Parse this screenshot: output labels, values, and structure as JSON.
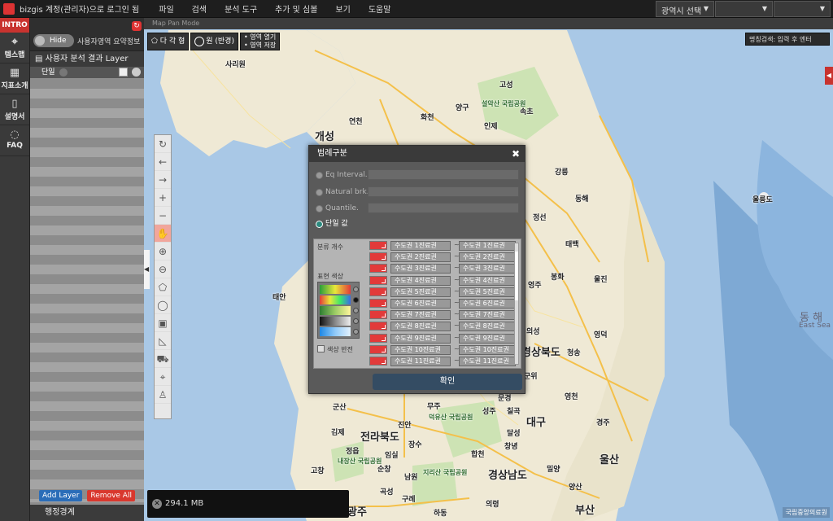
{
  "topbar": {
    "login_text": "bizgis 계정(관리자)으로 로그인 됨",
    "menus": [
      "파일",
      "검색",
      "분석 도구",
      "추가 및 심볼",
      "보기",
      "도움말"
    ],
    "region_select": "광역시 선택",
    "select2": "",
    "select3": ""
  },
  "leftnav": {
    "intro": "INTRO",
    "items": [
      {
        "label": "템스맵",
        "icon": "map-pin-icon"
      },
      {
        "label": "지표소개",
        "icon": "grid-icon"
      },
      {
        "label": "설명서",
        "icon": "book-icon"
      },
      {
        "label": "FAQ",
        "icon": "chat-icon"
      }
    ]
  },
  "panel": {
    "hide_label": "Hide",
    "summary_label": "사용자영역 요약정보",
    "layer_title": "사용자 분석 결과 Layer",
    "layer_item": "단일",
    "add_layer": "Add Layer",
    "remove_all": "Remove All",
    "boundary": "행정경계"
  },
  "map": {
    "mode_label": "Map Pan Mode",
    "tools": {
      "polygon": "다 각 형",
      "circle": "원 (반경)",
      "open_area": "• 영역 열기",
      "save_area": "• 영역 저장"
    },
    "place_search": "명칭검색: 입력 후 엔터",
    "memory": "294.1 MB",
    "copyright": "국립중앙의료원",
    "labels": [
      {
        "text": "개성",
        "cls": "big"
      },
      {
        "text": "사리원",
        "cls": ""
      },
      {
        "text": "양구",
        "cls": ""
      },
      {
        "text": "고성",
        "cls": ""
      },
      {
        "text": "속초",
        "cls": ""
      },
      {
        "text": "설악산 국립공원",
        "cls": "park"
      },
      {
        "text": "인제",
        "cls": ""
      },
      {
        "text": "화천",
        "cls": ""
      },
      {
        "text": "연천",
        "cls": ""
      },
      {
        "text": "강릉",
        "cls": ""
      },
      {
        "text": "동해",
        "cls": ""
      },
      {
        "text": "울릉도",
        "cls": ""
      },
      {
        "text": "정선",
        "cls": ""
      },
      {
        "text": "태백",
        "cls": ""
      },
      {
        "text": "봉화",
        "cls": ""
      },
      {
        "text": "영주",
        "cls": ""
      },
      {
        "text": "울진",
        "cls": ""
      },
      {
        "text": "영덕",
        "cls": ""
      },
      {
        "text": "청송",
        "cls": ""
      },
      {
        "text": "경상북도",
        "cls": "big"
      },
      {
        "text": "군위",
        "cls": ""
      },
      {
        "text": "영천",
        "cls": ""
      },
      {
        "text": "대구",
        "cls": "big"
      },
      {
        "text": "경주",
        "cls": ""
      },
      {
        "text": "울산",
        "cls": "big"
      },
      {
        "text": "밀양",
        "cls": ""
      },
      {
        "text": "양산",
        "cls": ""
      },
      {
        "text": "부산",
        "cls": "big"
      },
      {
        "text": "경상남도",
        "cls": "big"
      },
      {
        "text": "창녕",
        "cls": ""
      },
      {
        "text": "합천",
        "cls": ""
      },
      {
        "text": "의령",
        "cls": ""
      },
      {
        "text": "지리산 국립공원",
        "cls": "park"
      },
      {
        "text": "덕유산 국립공원",
        "cls": "park"
      },
      {
        "text": "무주",
        "cls": ""
      },
      {
        "text": "성주",
        "cls": ""
      },
      {
        "text": "칠곡",
        "cls": ""
      },
      {
        "text": "달성",
        "cls": ""
      },
      {
        "text": "김천",
        "cls": ""
      },
      {
        "text": "진안",
        "cls": ""
      },
      {
        "text": "장수",
        "cls": ""
      },
      {
        "text": "남원",
        "cls": ""
      },
      {
        "text": "구례",
        "cls": ""
      },
      {
        "text": "하동",
        "cls": ""
      },
      {
        "text": "곡성",
        "cls": ""
      },
      {
        "text": "광주",
        "cls": "big"
      },
      {
        "text": "순창",
        "cls": ""
      },
      {
        "text": "임실",
        "cls": ""
      },
      {
        "text": "정읍",
        "cls": ""
      },
      {
        "text": "전라북도",
        "cls": "big"
      },
      {
        "text": "김제",
        "cls": ""
      },
      {
        "text": "군산",
        "cls": ""
      },
      {
        "text": "고창",
        "cls": ""
      },
      {
        "text": "내장산 국립공원",
        "cls": "park"
      },
      {
        "text": "태안",
        "cls": ""
      },
      {
        "text": "동 해",
        "cls": "sea"
      },
      {
        "text": "East Sea",
        "cls": "sea"
      },
      {
        "text": "문경",
        "cls": ""
      },
      {
        "text": "상주",
        "cls": ""
      },
      {
        "text": "의성",
        "cls": ""
      }
    ]
  },
  "dialog": {
    "title": "범례구분",
    "options": [
      {
        "label": "Eq Interval.",
        "on": false
      },
      {
        "label": "Natural brk.",
        "on": false
      },
      {
        "label": "Quantile.",
        "on": false
      },
      {
        "label": "단일 값",
        "on": true
      }
    ],
    "class_count_label": "분류 개수",
    "color_label": "표현 색상",
    "invert_label": "색상 반전",
    "confirm": "확인",
    "swatch_color": "#e23a3a",
    "rows": [
      {
        "from": "수도권 1진료권",
        "to": "수도권 1진료권"
      },
      {
        "from": "수도권 2진료권",
        "to": "수도권 2진료권"
      },
      {
        "from": "수도권 3진료권",
        "to": "수도권 3진료권"
      },
      {
        "from": "수도권 4진료권",
        "to": "수도권 4진료권"
      },
      {
        "from": "수도권 5진료권",
        "to": "수도권 5진료권"
      },
      {
        "from": "수도권 6진료권",
        "to": "수도권 6진료권"
      },
      {
        "from": "수도권 7진료권",
        "to": "수도권 7진료권"
      },
      {
        "from": "수도권 8진료권",
        "to": "수도권 8진료권"
      },
      {
        "from": "수도권 9진료권",
        "to": "수도권 9진료권"
      },
      {
        "from": "수도권 10진료권",
        "to": "수도권 10진료권"
      },
      {
        "from": "수도권 11진료권",
        "to": "수도권 11진료권"
      }
    ],
    "ramps": [
      {
        "gradient": "linear-gradient(90deg,#2a9d3a,#e8e83a,#e23a3a)",
        "selected": false
      },
      {
        "gradient": "linear-gradient(90deg,#e23a3a,#e8e83a,#3ae86a,#3a6ae8)",
        "selected": true
      },
      {
        "gradient": "linear-gradient(90deg,#2e7d32,#9ccc65,#fff59d)",
        "selected": false
      },
      {
        "gradient": "linear-gradient(90deg,#111,#888,#eee)",
        "selected": false
      },
      {
        "gradient": "linear-gradient(90deg,#1e88e5,#90caf9,#e3f2fd)",
        "selected": false
      }
    ]
  }
}
